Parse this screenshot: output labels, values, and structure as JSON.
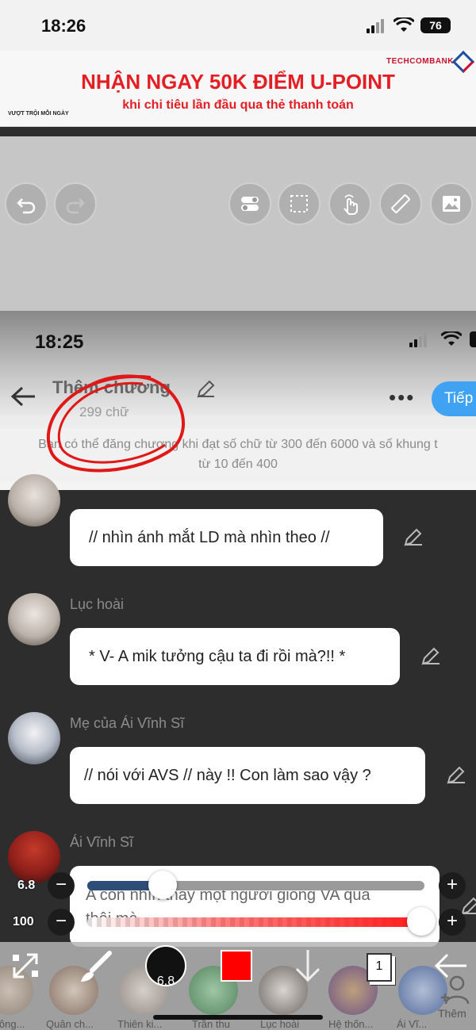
{
  "status_bar": {
    "time": "18:26",
    "battery": "76"
  },
  "ad": {
    "brand": "TECHCOMBANK",
    "headline": "NHẬN NGAY 50K ĐIỂM U-POINT",
    "subline": "khi chi tiêu lần đầu qua thẻ thanh toán",
    "slogan": "VƯỢT TRỘI MỖI NGÀY"
  },
  "editor_toolbar": {
    "buttons": [
      "undo-icon",
      "redo-icon",
      "toggle-icon",
      "selection-icon",
      "hand-tap-icon",
      "ruler-icon",
      "image-icon"
    ]
  },
  "screenshot": {
    "time": "18:25",
    "title": "Thêm chương",
    "word_count": "299 chữ",
    "more": "•••",
    "next_button": "Tiếp",
    "notice_line1": "Bạn có thể đăng chương khi đạt số chữ từ 300 đến 6000 và số khung t",
    "notice_line2": "từ 10 đến 400"
  },
  "messages": [
    {
      "speaker": "",
      "text": "// nhìn ánh mắt LD mà nhìn theo //"
    },
    {
      "speaker": "Lục hoài",
      "text": "* V- A mik tưởng cậu ta đi rồi mà?!! *"
    },
    {
      "speaker": "Mẹ của Ái Vĩnh Sĩ",
      "text": "// nói với AVS // này !! Con làm sao vậy ?"
    },
    {
      "speaker": "Ái Vĩnh Sĩ",
      "text_line1": "A con nhìn thấy một người giống VA qua",
      "text_line2": "thôi mà"
    }
  ],
  "brush_controls": {
    "size_value": "6.8",
    "opacity_value": "100",
    "size_fraction": 0.2,
    "opacity_fraction": 1.0,
    "minus": "−",
    "plus": "+"
  },
  "bottom_toolbar": {
    "brush_size": "6.8",
    "color": "#ff0000",
    "page_number": "1",
    "add_label": "Thêm",
    "characters": [
      "lông...",
      "Quân ch...",
      "Thiên ki...",
      "Trần thu",
      "Lục hoài",
      "Hệ thốn...",
      "Ái Vĩ..."
    ]
  }
}
